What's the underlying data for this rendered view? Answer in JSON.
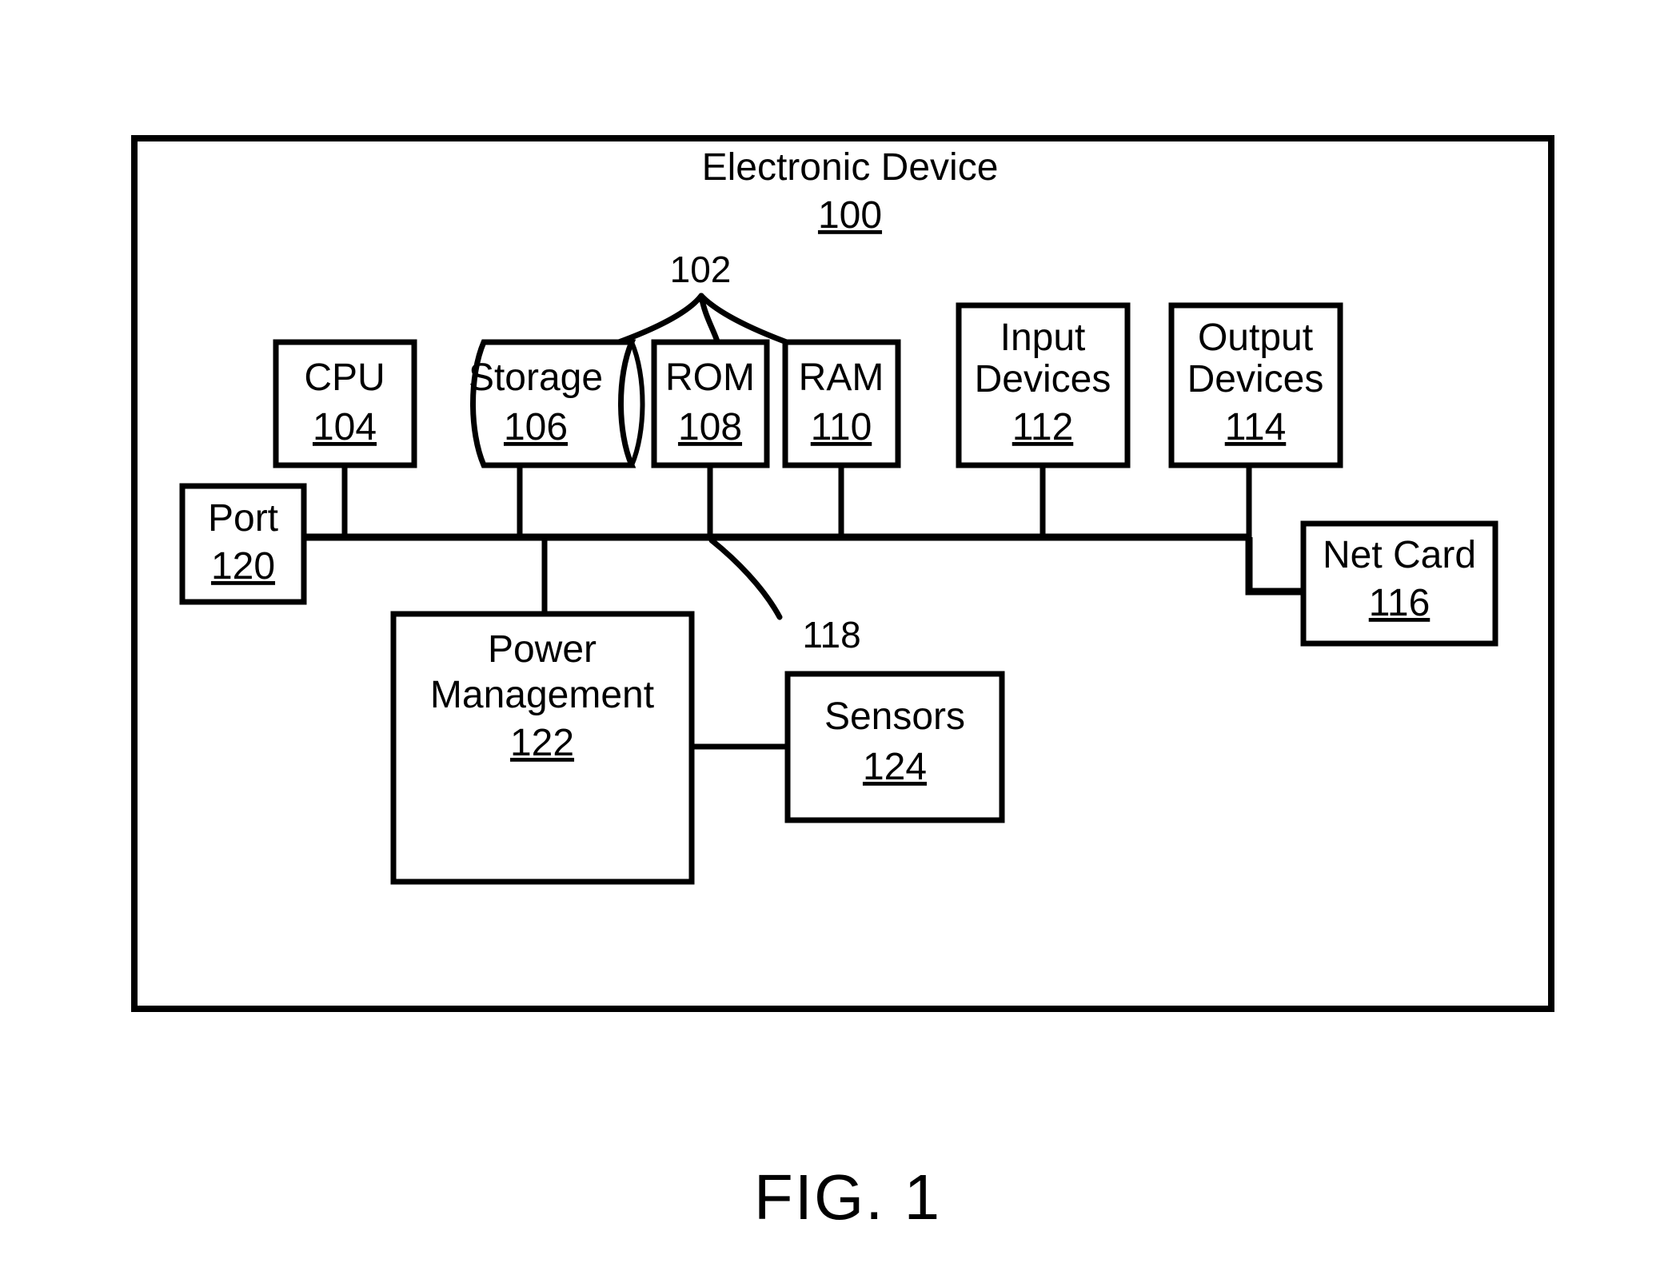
{
  "figure": {
    "caption": "FIG. 1",
    "outer_title": "Electronic Device",
    "outer_ref": "100"
  },
  "callouts": {
    "memory_group": "102",
    "bus": "118"
  },
  "blocks": {
    "cpu": {
      "label": "CPU",
      "ref": "104"
    },
    "storage": {
      "label": "Storage",
      "ref": "106"
    },
    "rom": {
      "label": "ROM",
      "ref": "108"
    },
    "ram": {
      "label": "RAM",
      "ref": "110"
    },
    "input": {
      "label_line1": "Input",
      "label_line2": "Devices",
      "ref": "112"
    },
    "output": {
      "label_line1": "Output",
      "label_line2": "Devices",
      "ref": "114"
    },
    "netcard": {
      "label": "Net Card",
      "ref": "116"
    },
    "port": {
      "label": "Port",
      "ref": "120"
    },
    "power": {
      "label_line1": "Power",
      "label_line2": "Management",
      "ref": "122"
    },
    "sensors": {
      "label": "Sensors",
      "ref": "124"
    }
  },
  "colors": {
    "ink": "#000000",
    "paper": "#ffffff"
  }
}
